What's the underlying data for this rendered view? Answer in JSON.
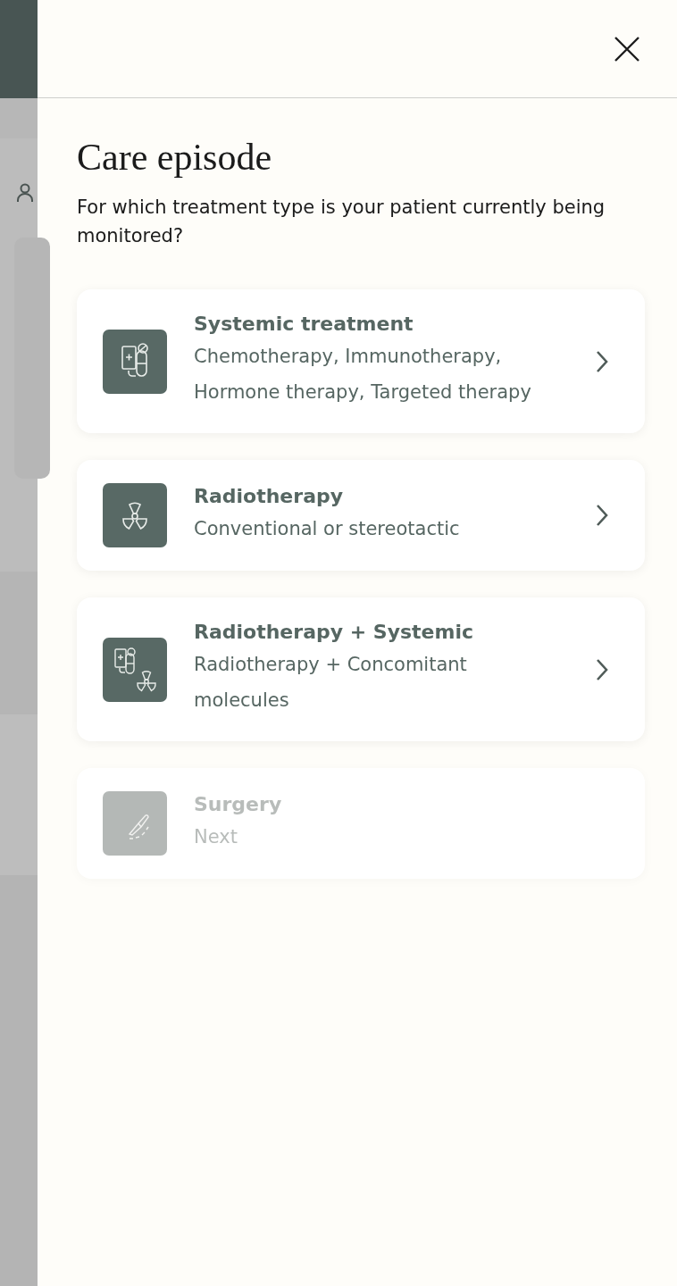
{
  "dialog": {
    "title": "Care episode",
    "question": "For which treatment type is your patient currently being monitored?"
  },
  "options": [
    {
      "kind": "systemic",
      "title": "Systemic treatment",
      "description": "Chemotherapy, Immunotherapy, Hormone therapy, Targeted therapy",
      "disabled": false
    },
    {
      "kind": "radio",
      "title": "Radiotherapy",
      "description": "Conventional or stereotactic",
      "disabled": false
    },
    {
      "kind": "combined",
      "title": "Radiotherapy + Systemic",
      "description": "Radiotherapy + Concomitant molecules",
      "disabled": false
    },
    {
      "kind": "surgery",
      "title": "Surgery",
      "description": "Next",
      "disabled": true
    }
  ]
}
